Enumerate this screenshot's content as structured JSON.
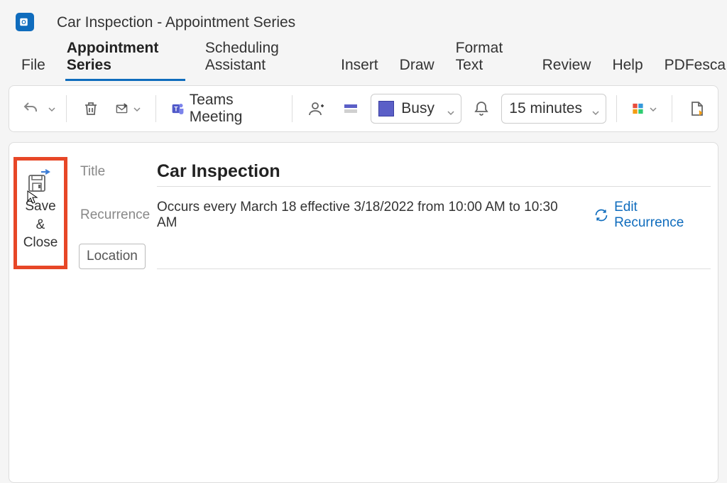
{
  "window": {
    "title": "Car Inspection  -  Appointment Series"
  },
  "tabs": [
    {
      "label": "File"
    },
    {
      "label": "Appointment Series"
    },
    {
      "label": "Scheduling Assistant"
    },
    {
      "label": "Insert"
    },
    {
      "label": "Draw"
    },
    {
      "label": "Format Text"
    },
    {
      "label": "Review"
    },
    {
      "label": "Help"
    },
    {
      "label": "PDFesca"
    }
  ],
  "toolbar": {
    "teams_meeting_label": "Teams Meeting",
    "status": {
      "label": "Busy",
      "color": "#5b5fc7"
    },
    "reminder": {
      "label": "15 minutes"
    }
  },
  "form": {
    "save_close_label": "Save\n&\nClose",
    "title_label": "Title",
    "title_value": "Car Inspection",
    "recurrence_label": "Recurrence",
    "recurrence_text": "Occurs every March 18 effective 3/18/2022 from 10:00 AM to 10:30 AM",
    "edit_recurrence_label": "Edit Recurrence",
    "location_label": "Location",
    "location_value": ""
  }
}
